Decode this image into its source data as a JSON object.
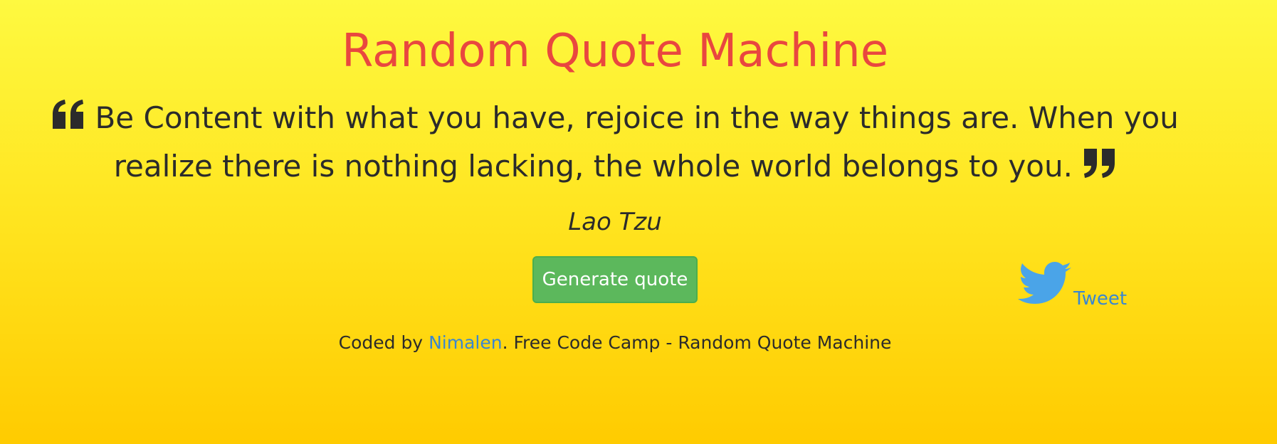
{
  "page": {
    "title": "Random Quote Machine"
  },
  "quote": {
    "text": "Be Content with what you have, rejoice in the way things are. When you realize there is nothing lacking, the whole world belongs to you.",
    "author": "Lao Tzu",
    "open_icon": "quote-left-icon",
    "close_icon": "quote-right-icon"
  },
  "actions": {
    "generate_label": "Generate quote",
    "tweet_label": "Tweet",
    "tweet_icon": "twitter-bird-icon"
  },
  "footer": {
    "prefix": "Coded by ",
    "author_link": "Nimalen",
    "suffix": ". Free Code Camp - Random Quote Machine"
  },
  "colors": {
    "title": "#e9473f",
    "text": "#2b2b2b",
    "button": "#5cb85c",
    "link": "#3a87d0",
    "twitter": "#4aa4e8",
    "background_top": "#fef940",
    "background_bottom": "#ffcb00"
  }
}
